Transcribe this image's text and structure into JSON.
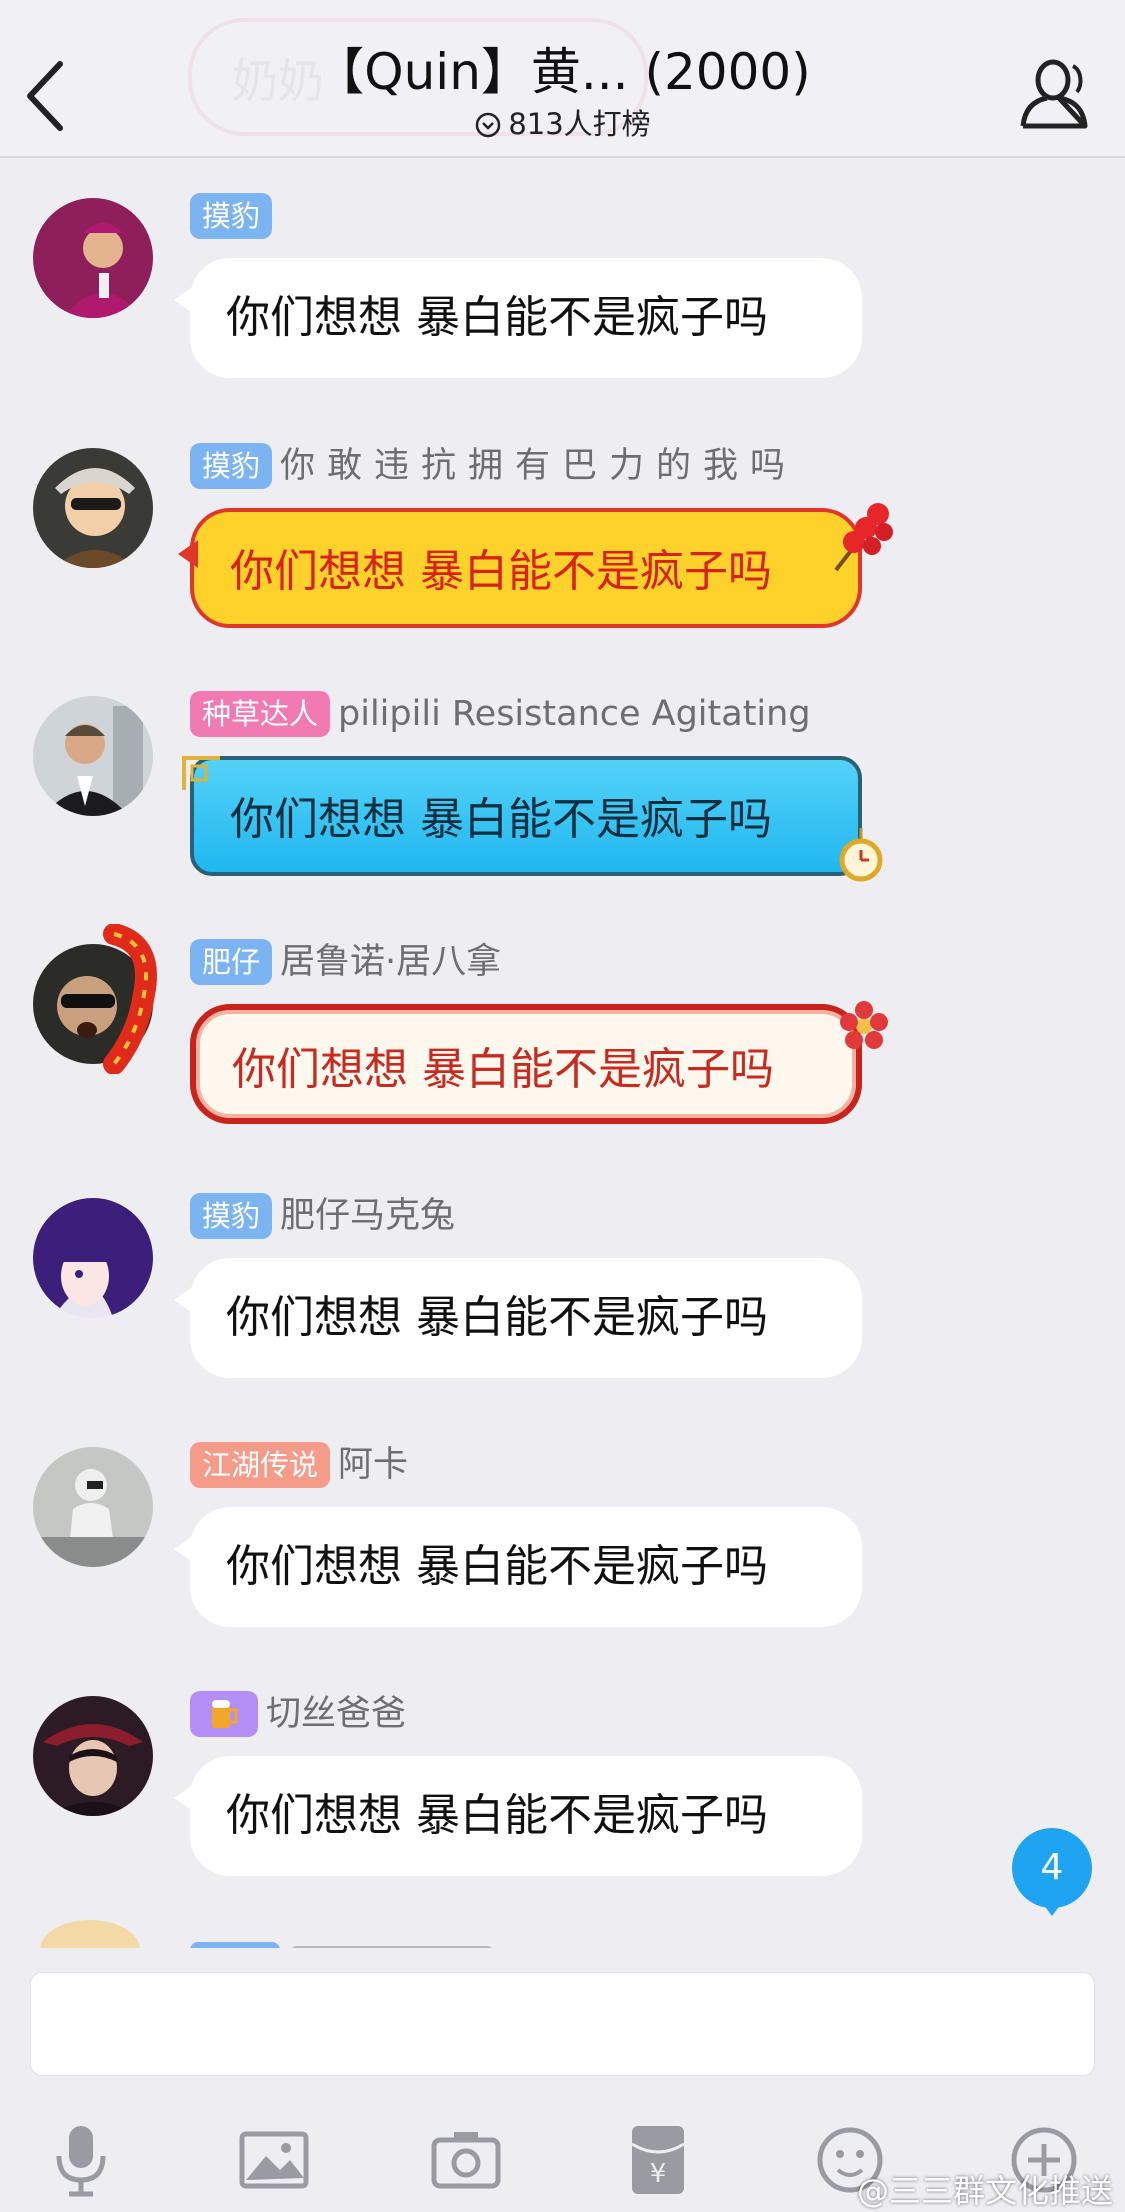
{
  "header": {
    "title": "【Quin】黄... (2000)",
    "subtitle": "813人打榜",
    "background_ghost_text": "奶奶"
  },
  "messages": [
    {
      "badge": "摸豹",
      "badge_color": "#7cb4f2",
      "nickname": "",
      "text": "你们想想 暴白能不是疯子吗",
      "bubble_style": "plain"
    },
    {
      "badge": "摸豹",
      "badge_color": "#7cb4f2",
      "nickname": "你敢违抗拥有巴力的我吗",
      "text": "你们想想 暴白能不是疯子吗",
      "bubble_style": "yellow"
    },
    {
      "badge": "种草达人",
      "badge_color": "#f27ab3",
      "nickname": "pilipili Resistance Agitating",
      "text": "你们想想 暴白能不是疯子吗",
      "bubble_style": "blue"
    },
    {
      "badge": "肥仔",
      "badge_color": "#7cb4f2",
      "nickname": "居鲁诺·居八拿",
      "text": "你们想想 暴白能不是疯子吗",
      "bubble_style": "festive"
    },
    {
      "badge": "摸豹",
      "badge_color": "#7cb4f2",
      "nickname": "肥仔马克兔",
      "text": "你们想想 暴白能不是疯子吗",
      "bubble_style": "plain"
    },
    {
      "badge": "江湖传说",
      "badge_color": "#f59b89",
      "nickname": "阿卡",
      "text": "你们想想 暴白能不是疯子吗",
      "bubble_style": "plain"
    },
    {
      "badge_icon": "beer-mug-icon",
      "badge_color": "#b28ef5",
      "nickname": "切丝爸爸",
      "text": "你们想想 暴白能不是疯子吗",
      "bubble_style": "plain"
    }
  ],
  "unread_count": "4",
  "input": {
    "value": ""
  },
  "toolbar": {
    "icons": [
      "microphone-icon",
      "image-icon",
      "camera-icon",
      "red-packet-icon",
      "emoji-icon",
      "plus-icon"
    ]
  },
  "watermark": "@三三群文化推送",
  "colors": {
    "background": "#ededf2",
    "badge_blue": "#7cb4f2",
    "badge_pink": "#f27ab3",
    "badge_salmon": "#f59b89",
    "badge_purple": "#b28ef5",
    "unread_blue": "#1ea4f1"
  }
}
